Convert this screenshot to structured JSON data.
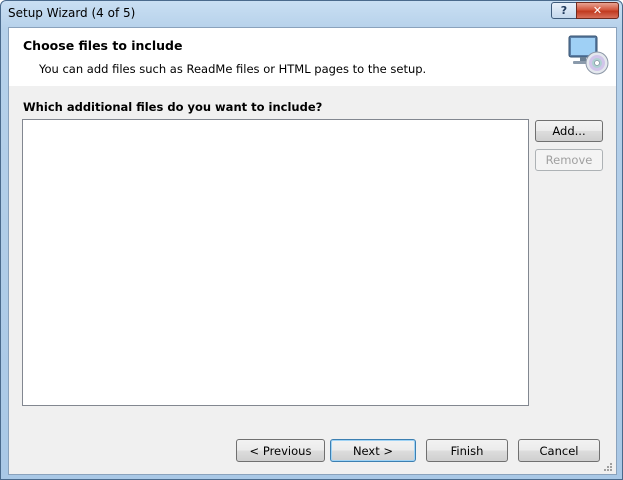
{
  "window": {
    "title": "Setup Wizard (4 of 5)",
    "help_glyph": "?",
    "close_glyph": "✕"
  },
  "header": {
    "title": "Choose files to include",
    "subtitle": "You can add files such as ReadMe files or HTML pages to the setup.",
    "icon": "computer-disc-icon"
  },
  "files": {
    "label": "Which additional files do you want to include?",
    "items": []
  },
  "side_buttons": {
    "add": "Add...",
    "remove": "Remove"
  },
  "footer": {
    "previous": "< Previous",
    "next": "Next >",
    "finish": "Finish",
    "cancel": "Cancel"
  },
  "colors": {
    "title_bar": "#b6d1ea",
    "client_bg": "#f0f0f0",
    "close_red": "#c13a1f"
  }
}
